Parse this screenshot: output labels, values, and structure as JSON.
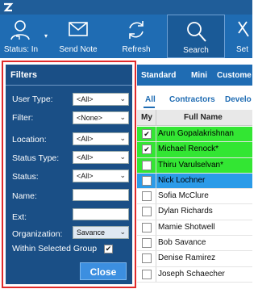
{
  "toolbar": {
    "status_label": "Status: In",
    "send_note_label": "Send Note",
    "refresh_label": "Refresh",
    "search_label": "Search",
    "settings_label": "Set"
  },
  "view_tabs": [
    "Standard",
    "Mini",
    "Custome"
  ],
  "sub_tabs": [
    "All",
    "Contractors",
    "Develo"
  ],
  "grid": {
    "col_my": "My",
    "col_name": "Full Name",
    "rows": [
      {
        "name": "Arun Gopalakrishnan",
        "checked": true,
        "color": "#33e633"
      },
      {
        "name": "Michael Renock*",
        "checked": true,
        "color": "#33e633"
      },
      {
        "name": "Thiru Varulselvan*",
        "checked": false,
        "color": "#33e633"
      },
      {
        "name": "Nick Lochner",
        "checked": false,
        "color": "#2b9be8"
      },
      {
        "name": "Sofia McClure",
        "checked": false,
        "color": "#ffffff"
      },
      {
        "name": "Dylan Richards",
        "checked": false,
        "color": "#ffffff"
      },
      {
        "name": "Mamie Shotwell",
        "checked": false,
        "color": "#ffffff"
      },
      {
        "name": "Bob Savance",
        "checked": false,
        "color": "#ffffff"
      },
      {
        "name": "Denise Ramirez",
        "checked": false,
        "color": "#ffffff"
      },
      {
        "name": "Joseph Schaecher",
        "checked": false,
        "color": "#ffffff"
      }
    ]
  },
  "filters": {
    "title": "Filters",
    "user_type_label": "User Type:",
    "user_type_value": "<All>",
    "filter_label": "Filter:",
    "filter_value": "<None>",
    "location_label": "Location:",
    "location_value": "<All>",
    "status_type_label": "Status Type:",
    "status_type_value": "<All>",
    "status_label": "Status:",
    "status_value": "<All>",
    "name_label": "Name:",
    "name_value": "",
    "ext_label": "Ext:",
    "ext_value": "",
    "organization_label": "Organization:",
    "organization_value": "Savance",
    "within_group_label": "Within Selected Group",
    "within_group_checked": true,
    "close_label": "Close"
  },
  "colors": {
    "title_bar": "#1f5d99",
    "toolbar": "#1f6cb3",
    "filters_panel": "#1a4f86",
    "filters_border": "#e02a2a",
    "close_button": "#3c8fe0"
  }
}
